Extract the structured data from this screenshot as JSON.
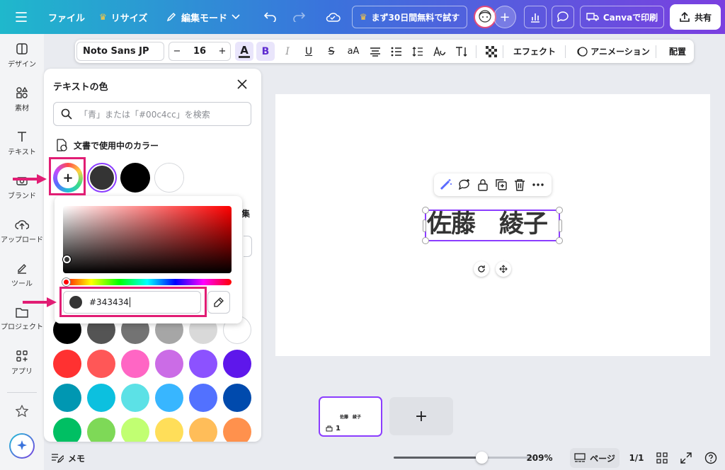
{
  "topbar": {
    "file": "ファイル",
    "resize": "リサイズ",
    "edit_mode": "編集モード",
    "trial": "まず30日間無料で試す",
    "print": "Canvaで印刷",
    "share": "共有"
  },
  "toolbar": {
    "font": "Noto Sans JP",
    "minus": "−",
    "font_size": "16",
    "plus": "+",
    "text_color_glyph": "A",
    "bold": "B",
    "italic": "I",
    "underline": "U",
    "strike": "S",
    "case": "aA",
    "effects": "エフェクト",
    "animation": "アニメーション",
    "position": "配置"
  },
  "rail": {
    "items": [
      {
        "label": "デザイン",
        "icon": "design-icon"
      },
      {
        "label": "素材",
        "icon": "elements-icon"
      },
      {
        "label": "テキスト",
        "icon": "text-icon"
      },
      {
        "label": "ブランド",
        "icon": "brand-icon"
      },
      {
        "label": "アップロード",
        "icon": "upload-icon"
      },
      {
        "label": "ツール",
        "icon": "tools-icon"
      },
      {
        "label": "プロジェクト",
        "icon": "folder-icon"
      },
      {
        "label": "アプリ",
        "icon": "apps-icon"
      }
    ]
  },
  "panel": {
    "title": "テキストの色",
    "search_placeholder": "「青」または「#00c4cc」を検索",
    "doc_colors_title": "文書で使用中のカラー",
    "doc_colors": [
      "#343434",
      "#000000",
      "#ffffff"
    ],
    "hidden_edge": "集",
    "default_colors": [
      [
        "#000000",
        "#545454",
        "#737373",
        "#a6a6a6",
        "#d9d9d9",
        "#ffffff"
      ],
      [
        "#ff3131",
        "#ff5757",
        "#ff66c4",
        "#cb6ce6",
        "#8c52ff",
        "#5e17eb"
      ],
      [
        "#0097b2",
        "#0cc0df",
        "#5ce1e6",
        "#38b6ff",
        "#5271ff",
        "#004aad"
      ],
      [
        "#00bf63",
        "#7ed957",
        "#c1ff72",
        "#ffde59",
        "#ffbd59",
        "#ff914d"
      ]
    ]
  },
  "picker": {
    "hex_value": "#343434",
    "hue": "#ff0000",
    "selected_color": "#343434"
  },
  "canvas": {
    "text": "佐藤　綾子",
    "text_color": "#343434"
  },
  "bottom": {
    "memo": "メモ",
    "zoom": "209%",
    "zoom_fraction": 0.62,
    "pages": "ページ",
    "page_count": "1/1",
    "thumb_text": "佐藤　綾子",
    "thumb_number": "1",
    "add_page": "+"
  },
  "colors": {
    "accent": "#8b3dff",
    "annotation": "#e11d74"
  }
}
